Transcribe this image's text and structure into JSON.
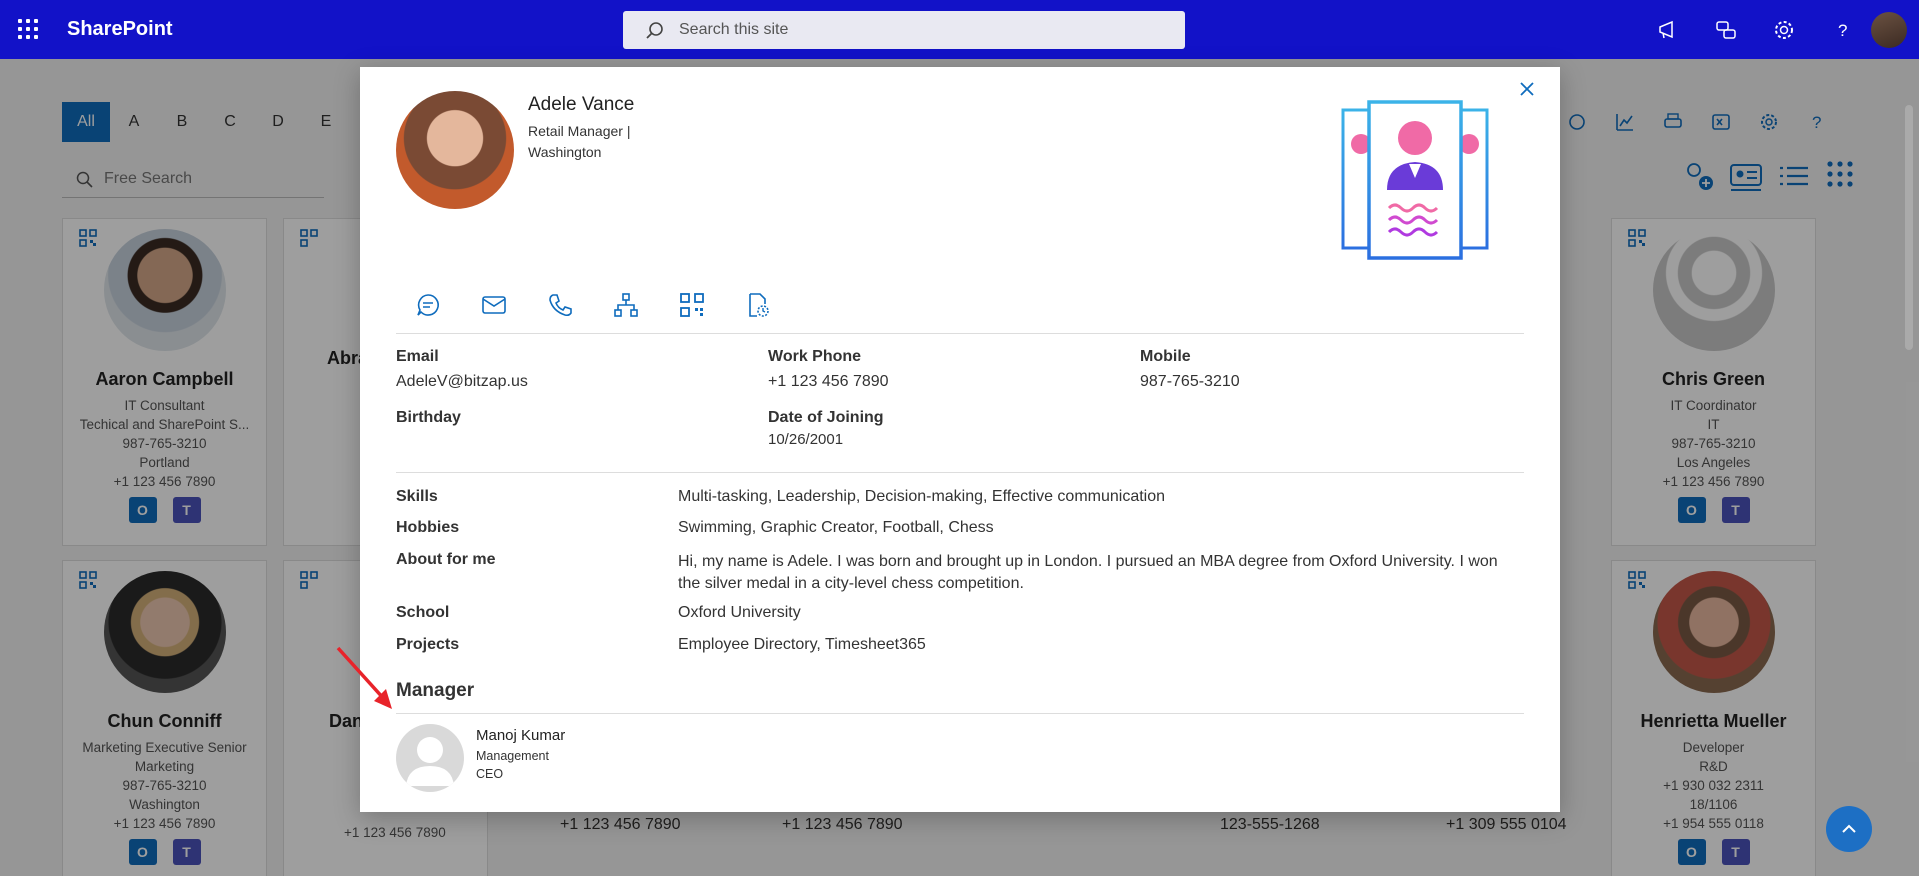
{
  "topbar": {
    "brand": "SharePoint",
    "search_placeholder": "Search this site",
    "icons": [
      "megaphone-icon",
      "chat-help-icon",
      "settings-icon",
      "help-icon"
    ]
  },
  "directory": {
    "letters": [
      "All",
      "A",
      "B",
      "C",
      "D",
      "E"
    ],
    "free_search_placeholder": "Free Search",
    "cards": [
      {
        "name": "Aaron Campbell",
        "title": "IT Consultant",
        "dept": "Techical and SharePoint S...",
        "mobile": "987-765-3210",
        "location": "Portland",
        "phone": "+1 123 456 7890"
      },
      {
        "name": "Chris Green",
        "title": "IT Coordinator",
        "dept": "IT",
        "mobile": "987-765-3210",
        "location": "Los Angeles",
        "phone": "+1 123 456 7890"
      },
      {
        "name": "Chun Conniff",
        "title": "Marketing Executive Senior",
        "dept": "Marketing",
        "mobile": "987-765-3210",
        "location": "Washington",
        "phone": "+1 123 456 7890"
      },
      {
        "name": "Henrietta Mueller",
        "title": "Developer",
        "dept": "R&D",
        "mobile": "+1 930 032 2311",
        "location": "18/1106",
        "phone": "+1 954 555 0118"
      }
    ],
    "partial_names": [
      "Abra",
      "Dan"
    ],
    "partial_phones": [
      "+1 123 456 7890",
      "+1 123 456 7890",
      "+1 123 456 7890",
      "123-555-1268",
      "+1 309 555 0104"
    ]
  },
  "profile": {
    "name": "Adele Vance",
    "title_line": "Retail Manager |",
    "location_line": "Washington",
    "fields": {
      "email_label": "Email",
      "email": "AdeleV@bitzap.us",
      "work_phone_label": "Work Phone",
      "work_phone": "+1 123 456 7890",
      "mobile_label": "Mobile",
      "mobile": "987-765-3210",
      "birthday_label": "Birthday",
      "doj_label": "Date of Joining",
      "doj": "10/26/2001"
    },
    "details": {
      "skills_label": "Skills",
      "skills": "Multi-tasking, Leadership, Decision-making, Effective communication",
      "hobbies_label": "Hobbies",
      "hobbies": "Swimming, Graphic Creator, Football, Chess",
      "about_label": "About for me",
      "about": "Hi, my name is Adele. I was born and brought up in London. I pursued an MBA degree from Oxford University. I won the silver medal in a city-level chess competition.",
      "school_label": "School",
      "school": "Oxford University",
      "projects_label": "Projects",
      "projects": "Employee Directory, Timesheet365"
    },
    "manager": {
      "section_title": "Manager",
      "name": "Manoj Kumar",
      "department": "Management",
      "title": "CEO"
    }
  },
  "colors": {
    "topbar": "#1212c8",
    "accent": "#0f6cbd",
    "arrow": "#e8232a"
  }
}
